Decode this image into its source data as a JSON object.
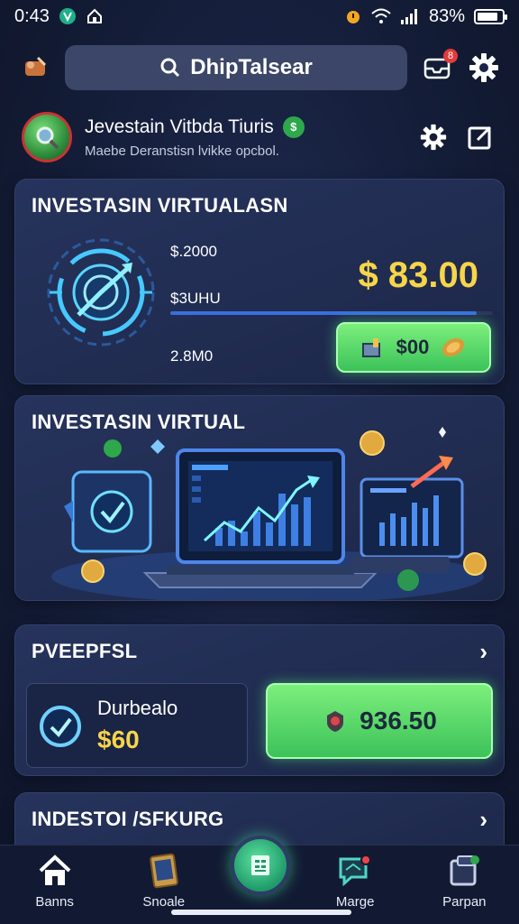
{
  "status_bar": {
    "time": "0:43",
    "battery": "83%",
    "battery_level": 0.83
  },
  "search": {
    "text": "DhipTalsear"
  },
  "header": {
    "notification_count": "8"
  },
  "profile": {
    "name": "Jevestain Vitbda Tiuris",
    "subtitle": "Maebe Deranstisn lvikke opcbol."
  },
  "invest_card": {
    "title": "INVESTASIN VIRTUALASN",
    "label_top": "$.2000",
    "label_mid": "$3UHU",
    "label_bottom": "2.8M0",
    "amount": "$ 83.00",
    "button_label": "$00",
    "progress": 0.95
  },
  "virtual_card": {
    "title": "INVESTASIN VIRTUAL"
  },
  "pveepfsl_card": {
    "title": "PVEEPFSL",
    "sub_label": "Durbealo",
    "sub_amount": "$60",
    "button_label": "936.50"
  },
  "indestoi_card": {
    "title": "INDESTOI /SFKURG"
  },
  "bottom_nav": {
    "items": [
      {
        "label": "Banns",
        "icon": "home-icon"
      },
      {
        "label": "Snoale",
        "icon": "tablet-icon"
      },
      {
        "label": "Marge",
        "icon": "chat-icon"
      },
      {
        "label": "Parpan",
        "icon": "wallet-icon"
      }
    ]
  },
  "colors": {
    "accent_green": "#3cc25a",
    "amount_yellow": "#f7d54a",
    "background": "#141d38"
  }
}
